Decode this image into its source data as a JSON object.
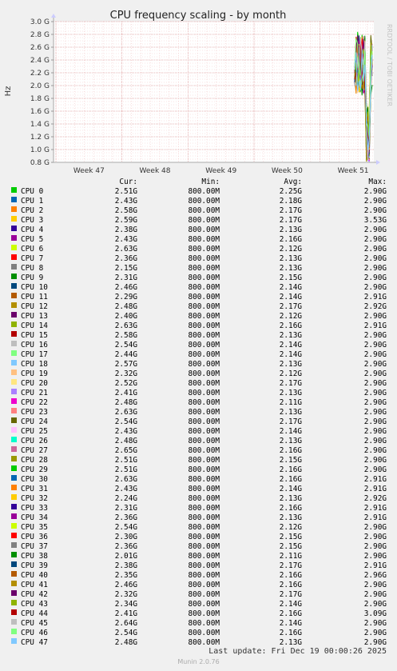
{
  "chart_data": {
    "type": "line",
    "title": "CPU frequency scaling - by month",
    "ylabel": "Hz",
    "y_ticks": [
      "0.8 G",
      "1.0 G",
      "1.2 G",
      "1.4 G",
      "1.6 G",
      "1.8 G",
      "2.0 G",
      "2.2 G",
      "2.4 G",
      "2.6 G",
      "2.8 G",
      "3.0 G"
    ],
    "ylim": [
      0.8,
      3.0
    ],
    "x_ticks": [
      "Week 47",
      "Week 48",
      "Week 49",
      "Week 50",
      "Week 51"
    ],
    "grid": true,
    "side_label": "RRDTOOL / TOBI OETIKER"
  },
  "legend": {
    "headers": {
      "cur": "Cur:",
      "min": "Min:",
      "avg": "Avg:",
      "max": "Max:"
    },
    "rows": [
      {
        "name": "CPU 0",
        "color": "#00cc00",
        "cur": "2.51G",
        "min": "800.00M",
        "avg": "2.25G",
        "max": "2.90G"
      },
      {
        "name": "CPU 1",
        "color": "#0066b3",
        "cur": "2.43G",
        "min": "800.00M",
        "avg": "2.18G",
        "max": "2.90G"
      },
      {
        "name": "CPU 2",
        "color": "#ff8000",
        "cur": "2.58G",
        "min": "800.00M",
        "avg": "2.17G",
        "max": "2.90G"
      },
      {
        "name": "CPU 3",
        "color": "#ffcc00",
        "cur": "2.59G",
        "min": "800.00M",
        "avg": "2.17G",
        "max": "3.53G"
      },
      {
        "name": "CPU 4",
        "color": "#330099",
        "cur": "2.38G",
        "min": "800.00M",
        "avg": "2.13G",
        "max": "2.90G"
      },
      {
        "name": "CPU 5",
        "color": "#990099",
        "cur": "2.43G",
        "min": "800.00M",
        "avg": "2.16G",
        "max": "2.90G"
      },
      {
        "name": "CPU 6",
        "color": "#ccff00",
        "cur": "2.63G",
        "min": "800.00M",
        "avg": "2.12G",
        "max": "2.90G"
      },
      {
        "name": "CPU 7",
        "color": "#ff0000",
        "cur": "2.36G",
        "min": "800.00M",
        "avg": "2.13G",
        "max": "2.90G"
      },
      {
        "name": "CPU 8",
        "color": "#808080",
        "cur": "2.15G",
        "min": "800.00M",
        "avg": "2.13G",
        "max": "2.90G"
      },
      {
        "name": "CPU 9",
        "color": "#008f00",
        "cur": "2.31G",
        "min": "800.00M",
        "avg": "2.15G",
        "max": "2.90G"
      },
      {
        "name": "CPU 10",
        "color": "#00487d",
        "cur": "2.46G",
        "min": "800.00M",
        "avg": "2.14G",
        "max": "2.90G"
      },
      {
        "name": "CPU 11",
        "color": "#b35a00",
        "cur": "2.29G",
        "min": "800.00M",
        "avg": "2.14G",
        "max": "2.91G"
      },
      {
        "name": "CPU 12",
        "color": "#b38f00",
        "cur": "2.48G",
        "min": "800.00M",
        "avg": "2.17G",
        "max": "2.92G"
      },
      {
        "name": "CPU 13",
        "color": "#6b006b",
        "cur": "2.40G",
        "min": "800.00M",
        "avg": "2.12G",
        "max": "2.90G"
      },
      {
        "name": "CPU 14",
        "color": "#8fb300",
        "cur": "2.63G",
        "min": "800.00M",
        "avg": "2.16G",
        "max": "2.91G"
      },
      {
        "name": "CPU 15",
        "color": "#b30000",
        "cur": "2.58G",
        "min": "800.00M",
        "avg": "2.13G",
        "max": "2.90G"
      },
      {
        "name": "CPU 16",
        "color": "#bebebe",
        "cur": "2.54G",
        "min": "800.00M",
        "avg": "2.14G",
        "max": "2.90G"
      },
      {
        "name": "CPU 17",
        "color": "#80ff80",
        "cur": "2.44G",
        "min": "800.00M",
        "avg": "2.14G",
        "max": "2.90G"
      },
      {
        "name": "CPU 18",
        "color": "#80c9ff",
        "cur": "2.57G",
        "min": "800.00M",
        "avg": "2.13G",
        "max": "2.90G"
      },
      {
        "name": "CPU 19",
        "color": "#ffc080",
        "cur": "2.32G",
        "min": "800.00M",
        "avg": "2.12G",
        "max": "2.90G"
      },
      {
        "name": "CPU 20",
        "color": "#ffe680",
        "cur": "2.52G",
        "min": "800.00M",
        "avg": "2.17G",
        "max": "2.90G"
      },
      {
        "name": "CPU 21",
        "color": "#aa80ff",
        "cur": "2.41G",
        "min": "800.00M",
        "avg": "2.13G",
        "max": "2.90G"
      },
      {
        "name": "CPU 22",
        "color": "#ee00cc",
        "cur": "2.48G",
        "min": "800.00M",
        "avg": "2.11G",
        "max": "2.90G"
      },
      {
        "name": "CPU 23",
        "color": "#ff8080",
        "cur": "2.63G",
        "min": "800.00M",
        "avg": "2.13G",
        "max": "2.90G"
      },
      {
        "name": "CPU 24",
        "color": "#666600",
        "cur": "2.54G",
        "min": "800.00M",
        "avg": "2.17G",
        "max": "2.90G"
      },
      {
        "name": "CPU 25",
        "color": "#ffbfff",
        "cur": "2.43G",
        "min": "800.00M",
        "avg": "2.14G",
        "max": "2.90G"
      },
      {
        "name": "CPU 26",
        "color": "#00ffcc",
        "cur": "2.48G",
        "min": "800.00M",
        "avg": "2.13G",
        "max": "2.90G"
      },
      {
        "name": "CPU 27",
        "color": "#cc6699",
        "cur": "2.65G",
        "min": "800.00M",
        "avg": "2.16G",
        "max": "2.90G"
      },
      {
        "name": "CPU 28",
        "color": "#999900",
        "cur": "2.51G",
        "min": "800.00M",
        "avg": "2.15G",
        "max": "2.90G"
      },
      {
        "name": "CPU 29",
        "color": "#00cc00",
        "cur": "2.51G",
        "min": "800.00M",
        "avg": "2.16G",
        "max": "2.90G"
      },
      {
        "name": "CPU 30",
        "color": "#0066b3",
        "cur": "2.63G",
        "min": "800.00M",
        "avg": "2.16G",
        "max": "2.91G"
      },
      {
        "name": "CPU 31",
        "color": "#ff8000",
        "cur": "2.43G",
        "min": "800.00M",
        "avg": "2.14G",
        "max": "2.91G"
      },
      {
        "name": "CPU 32",
        "color": "#ffcc00",
        "cur": "2.24G",
        "min": "800.00M",
        "avg": "2.13G",
        "max": "2.92G"
      },
      {
        "name": "CPU 33",
        "color": "#330099",
        "cur": "2.31G",
        "min": "800.00M",
        "avg": "2.16G",
        "max": "2.91G"
      },
      {
        "name": "CPU 34",
        "color": "#990099",
        "cur": "2.36G",
        "min": "800.00M",
        "avg": "2.13G",
        "max": "2.91G"
      },
      {
        "name": "CPU 35",
        "color": "#ccff00",
        "cur": "2.54G",
        "min": "800.00M",
        "avg": "2.12G",
        "max": "2.90G"
      },
      {
        "name": "CPU 36",
        "color": "#ff0000",
        "cur": "2.30G",
        "min": "800.00M",
        "avg": "2.15G",
        "max": "2.90G"
      },
      {
        "name": "CPU 37",
        "color": "#808080",
        "cur": "2.36G",
        "min": "800.00M",
        "avg": "2.15G",
        "max": "2.90G"
      },
      {
        "name": "CPU 38",
        "color": "#008f00",
        "cur": "2.01G",
        "min": "800.00M",
        "avg": "2.11G",
        "max": "2.90G"
      },
      {
        "name": "CPU 39",
        "color": "#00487d",
        "cur": "2.38G",
        "min": "800.00M",
        "avg": "2.17G",
        "max": "2.91G"
      },
      {
        "name": "CPU 40",
        "color": "#b35a00",
        "cur": "2.35G",
        "min": "800.00M",
        "avg": "2.16G",
        "max": "2.96G"
      },
      {
        "name": "CPU 41",
        "color": "#b38f00",
        "cur": "2.46G",
        "min": "800.00M",
        "avg": "2.16G",
        "max": "2.90G"
      },
      {
        "name": "CPU 42",
        "color": "#6b006b",
        "cur": "2.32G",
        "min": "800.00M",
        "avg": "2.17G",
        "max": "2.90G"
      },
      {
        "name": "CPU 43",
        "color": "#8fb300",
        "cur": "2.34G",
        "min": "800.00M",
        "avg": "2.14G",
        "max": "2.90G"
      },
      {
        "name": "CPU 44",
        "color": "#b30000",
        "cur": "2.41G",
        "min": "800.00M",
        "avg": "2.16G",
        "max": "3.09G"
      },
      {
        "name": "CPU 45",
        "color": "#bebebe",
        "cur": "2.64G",
        "min": "800.00M",
        "avg": "2.14G",
        "max": "2.90G"
      },
      {
        "name": "CPU 46",
        "color": "#80ff80",
        "cur": "2.54G",
        "min": "800.00M",
        "avg": "2.16G",
        "max": "2.90G"
      },
      {
        "name": "CPU 47",
        "color": "#80c9ff",
        "cur": "2.48G",
        "min": "800.00M",
        "avg": "2.13G",
        "max": "2.90G"
      }
    ]
  },
  "footer": {
    "last_update": "Last update: Fri Dec 19 00:00:26 2025",
    "version": "Munin 2.0.76"
  }
}
